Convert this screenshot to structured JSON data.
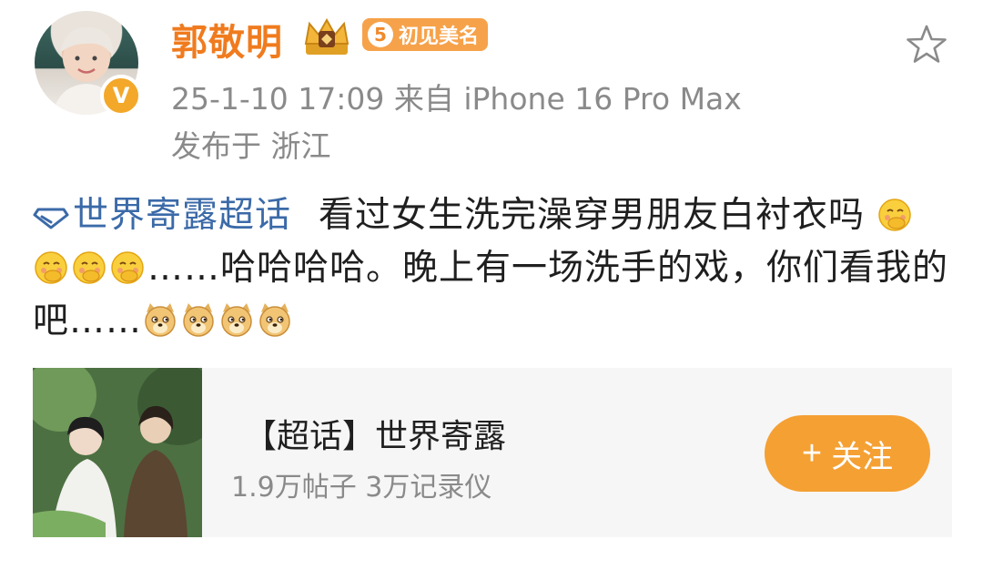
{
  "user": {
    "name": "郭敬明",
    "verified_mark": "V",
    "level": "5",
    "badge_text": "初见美名"
  },
  "meta": {
    "time_source": "25-1-10 17:09  来自 iPhone 16 Pro Max",
    "location": "发布于 浙江"
  },
  "post": {
    "topic": "世界寄露超话",
    "text_1": "看过女生洗完澡穿男朋友白衬衣吗",
    "text_2": "……哈哈哈哈。晚上有一场洗手的戏，你们看我的吧……"
  },
  "card": {
    "title": "【超话】世界寄露",
    "subtitle": "1.9万帖子  3万记录仪",
    "follow_label": "关注",
    "follow_plus": "+"
  },
  "colors": {
    "username": "#f07b1e",
    "link": "#3b6aa8",
    "follow_button": "#f5a033",
    "meta_text": "#8a8a8a"
  },
  "icons": [
    "crown-icon",
    "star-icon",
    "topic-diamond-icon",
    "shy-face-emoji",
    "doge-emoji"
  ]
}
